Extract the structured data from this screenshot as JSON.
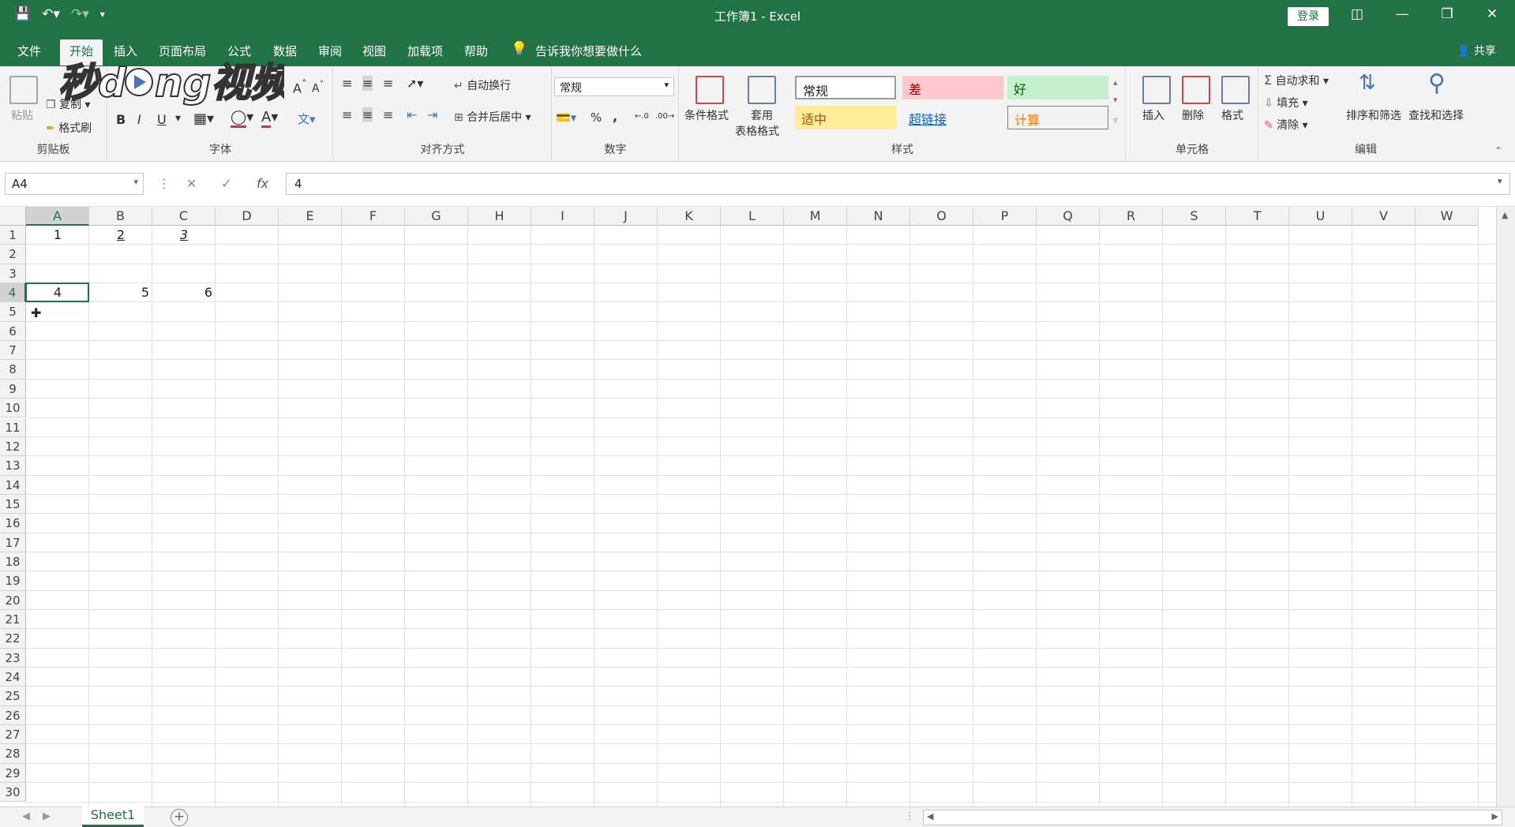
{
  "titlebar": {
    "title": "工作簿1 - Excel",
    "login_label": "登录"
  },
  "tabs": [
    {
      "label": "文件"
    },
    {
      "label": "开始"
    },
    {
      "label": "插入"
    },
    {
      "label": "页面布局"
    },
    {
      "label": "公式"
    },
    {
      "label": "数据"
    },
    {
      "label": "审阅"
    },
    {
      "label": "视图"
    },
    {
      "label": "加载项"
    },
    {
      "label": "帮助"
    }
  ],
  "tell_me": "告诉我你想要做什么",
  "share_label": "共享",
  "ribbon": {
    "clipboard": {
      "paste": "粘贴",
      "copy": "复制",
      "format_painter": "格式刷",
      "group": "剪贴板"
    },
    "font": {
      "bold": "B",
      "italic": "I",
      "underline": "U",
      "group": "字体"
    },
    "alignment": {
      "wrap": "自动换行",
      "merge": "合并后居中",
      "group": "对齐方式"
    },
    "number": {
      "format": "常规",
      "percent": "%",
      "comma": ",",
      "group": "数字"
    },
    "styles": {
      "conditional": "条件格式",
      "table_line1": "套用",
      "table_line2": "表格格式",
      "group": "样式",
      "normal": "常规",
      "bad": "差",
      "good": "好",
      "neutral": "适中",
      "hyperlink": "超链接",
      "calc": "计算"
    },
    "cells": {
      "insert": "插入",
      "delete": "删除",
      "format": "格式",
      "group": "单元格"
    },
    "editing": {
      "autosum": "自动求和",
      "fill": "填充",
      "clear": "清除",
      "sort": "排序和筛选",
      "find": "查找和选择",
      "group": "编辑"
    }
  },
  "watermark_text": "秒dong视频",
  "formula_bar": {
    "name_box": "A4",
    "fx": "fx",
    "value": "4"
  },
  "sheet": {
    "columns": [
      "A",
      "B",
      "C",
      "D",
      "E",
      "F",
      "G",
      "H",
      "I",
      "J",
      "K",
      "L",
      "M",
      "N",
      "O",
      "P",
      "Q",
      "R",
      "S",
      "T",
      "U",
      "V",
      "W"
    ],
    "rows": [
      "1",
      "2",
      "3",
      "4",
      "5",
      "6",
      "7",
      "8",
      "9",
      "10",
      "11",
      "12",
      "13",
      "14",
      "15",
      "16",
      "17",
      "18",
      "19",
      "20",
      "21",
      "22",
      "23",
      "24",
      "25",
      "26",
      "27",
      "28",
      "29",
      "30"
    ],
    "cells": {
      "A1": "1",
      "B1": "2",
      "C1": "3",
      "A4": "4",
      "B4": "5",
      "C4": "6"
    },
    "selected": "A4"
  },
  "sheet_tabs": [
    {
      "label": "Sheet1"
    }
  ],
  "colors": {
    "accent": "#217346",
    "ribbon_bg": "#f3f3f3"
  }
}
